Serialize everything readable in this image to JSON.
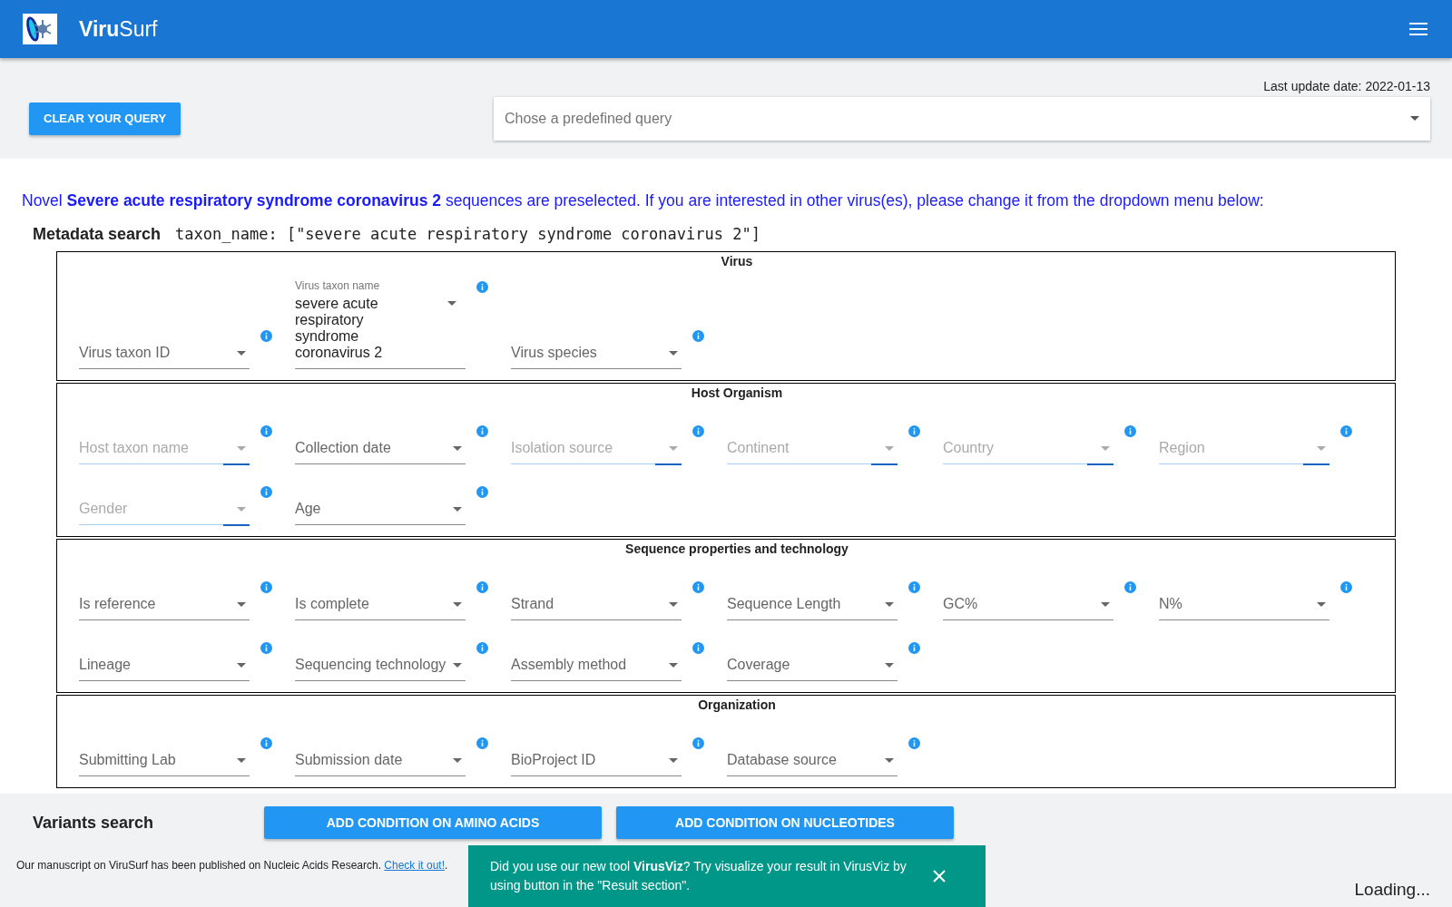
{
  "app_bar": {
    "title_bold": "Viru",
    "title_light": "Surf"
  },
  "top": {
    "last_update": "Last update date: 2022-01-13",
    "clear_button": "CLEAR YOUR QUERY",
    "predefined_query": {
      "placeholder": "Chose a predefined query"
    }
  },
  "notice": "Novel **Severe acute respiratory syndrome coronavirus 2** sequences are preselected. If you are interested in other virus(es), please change it from the dropdown menu below:",
  "metadata_search": {
    "label": "Metadata search",
    "query": "taxon_name: [\"severe acute respiratory syndrome coronavirus 2\"]"
  },
  "groups": [
    {
      "title": "Virus",
      "rows": [
        [
          {
            "label": "Virus taxon ID",
            "loading": false
          },
          {
            "label": "Virus taxon name",
            "value": "severe acute respiratory syndrome coronavirus 2",
            "loading": false
          },
          {
            "label": "Virus species",
            "loading": false
          }
        ]
      ]
    },
    {
      "title": "Host Organism",
      "rows": [
        [
          {
            "label": "Host taxon name",
            "loading": true
          },
          {
            "label": "Collection date",
            "loading": false
          },
          {
            "label": "Isolation source",
            "loading": true
          },
          {
            "label": "Continent",
            "loading": true
          },
          {
            "label": "Country",
            "loading": true
          },
          {
            "label": "Region",
            "loading": true
          }
        ],
        [
          {
            "label": "Gender",
            "loading": true
          },
          {
            "label": "Age",
            "loading": false
          }
        ]
      ]
    },
    {
      "title": "Sequence properties and technology",
      "rows": [
        [
          {
            "label": "Is reference",
            "loading": false
          },
          {
            "label": "Is complete",
            "loading": false
          },
          {
            "label": "Strand",
            "loading": false
          },
          {
            "label": "Sequence Length",
            "loading": false
          },
          {
            "label": "GC%",
            "loading": false
          },
          {
            "label": "N%",
            "loading": false
          }
        ],
        [
          {
            "label": "Lineage",
            "loading": false
          },
          {
            "label": "Sequencing technology",
            "loading": false
          },
          {
            "label": "Assembly method",
            "loading": false
          },
          {
            "label": "Coverage",
            "loading": false
          }
        ]
      ]
    },
    {
      "title": "Organization",
      "rows": [
        [
          {
            "label": "Submitting Lab",
            "loading": false
          },
          {
            "label": "Submission date",
            "loading": false
          },
          {
            "label": "BioProject ID",
            "loading": false
          },
          {
            "label": "Database source",
            "loading": false
          }
        ]
      ]
    }
  ],
  "variants_search": {
    "label": "Variants search",
    "buttons": [
      "ADD CONDITION ON AMINO ACIDS",
      "ADD CONDITION ON NUCLEOTIDES"
    ]
  },
  "footer": {
    "text": "Our manuscript on ViruSurf has been published on Nucleic Acids Research.",
    "link": "Check it out!",
    "after": "."
  },
  "status": "Loading...",
  "snackbar": {
    "text": "Did you use our new tool **VirusViz**? Try visualize your result in VirusViz by using button in the \"Result section\"."
  }
}
